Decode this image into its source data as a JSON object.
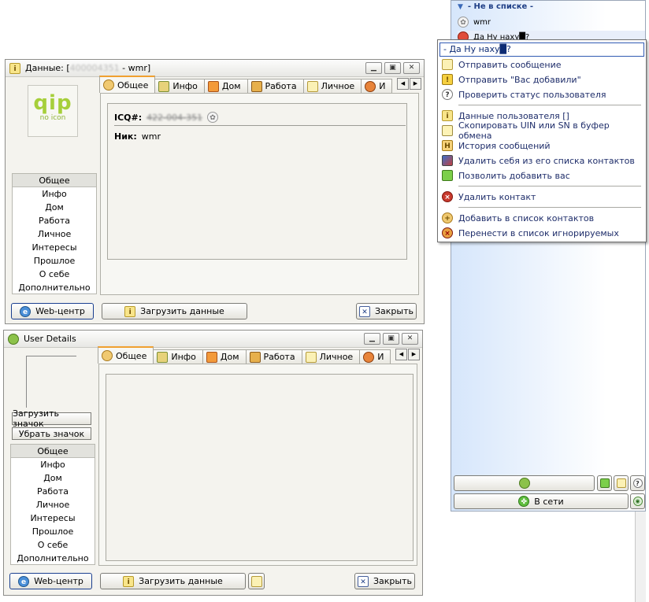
{
  "contact_list": {
    "group_label": "- Не в списке -",
    "contacts": [
      {
        "name": "wmr",
        "icon": "flower-icon"
      },
      {
        "name": "Да Ну наху█?",
        "icon": "person-icon"
      }
    ],
    "status_label": "В сети"
  },
  "context_menu": {
    "header": "- Да Ну наху█?",
    "items": [
      {
        "label": "Отправить сообщение",
        "icon": "message-icon"
      },
      {
        "label": "Отправить \"Вас добавили\"",
        "icon": "added-notify-icon"
      },
      {
        "label": "Проверить статус пользователя",
        "icon": "check-status-icon"
      },
      {
        "label": "Данные пользователя  []",
        "icon": "user-info-icon"
      },
      {
        "label": "Скопировать UIN или SN в буфер обмена",
        "icon": "copy-icon"
      },
      {
        "label": "История сообщений",
        "icon": "history-icon"
      },
      {
        "label": "Удалить себя из его списка контактов",
        "icon": "remove-self-icon"
      },
      {
        "label": "Позволить добавить вас",
        "icon": "allow-add-icon"
      },
      {
        "label": "Удалить контакт",
        "icon": "delete-contact-icon"
      },
      {
        "label": "Добавить в список контактов",
        "icon": "add-contact-icon"
      },
      {
        "label": "Перенести в список игнорируемых",
        "icon": "ignore-icon"
      }
    ]
  },
  "data_window": {
    "title": "Данные: [",
    "title_hidden": "400004351",
    "title_suffix": "- wmr]",
    "logo_line1": "qip",
    "logo_line2": "no icon",
    "tabs": [
      "Общее",
      "Инфо",
      "Дом",
      "Работа",
      "Личное",
      "И"
    ],
    "nav": [
      "Общее",
      "Инфо",
      "Дом",
      "Работа",
      "Личное",
      "Интересы",
      "Прошлое",
      "О себе",
      "Дополнительно"
    ],
    "icq_label": "ICQ#:",
    "icq_value": "422-004-351",
    "nick_label": "Ник:",
    "nick_value": "wmr",
    "webcenter_label": "Web-центр",
    "load_label": "Загрузить данные",
    "close_label": "Закрыть"
  },
  "details_window": {
    "title": "User Details",
    "tabs": [
      "Общее",
      "Инфо",
      "Дом",
      "Работа",
      "Личное",
      "И"
    ],
    "upload_icon_label": "Загрузить значок",
    "remove_icon_label": "Убрать значок",
    "nav": [
      "Общее",
      "Инфо",
      "Дом",
      "Работа",
      "Личное",
      "Интересы",
      "Прошлое",
      "О себе",
      "Дополнительно"
    ],
    "webcenter_label": "Web-центр",
    "load_label": "Загрузить данные",
    "close_label": "Закрыть"
  }
}
